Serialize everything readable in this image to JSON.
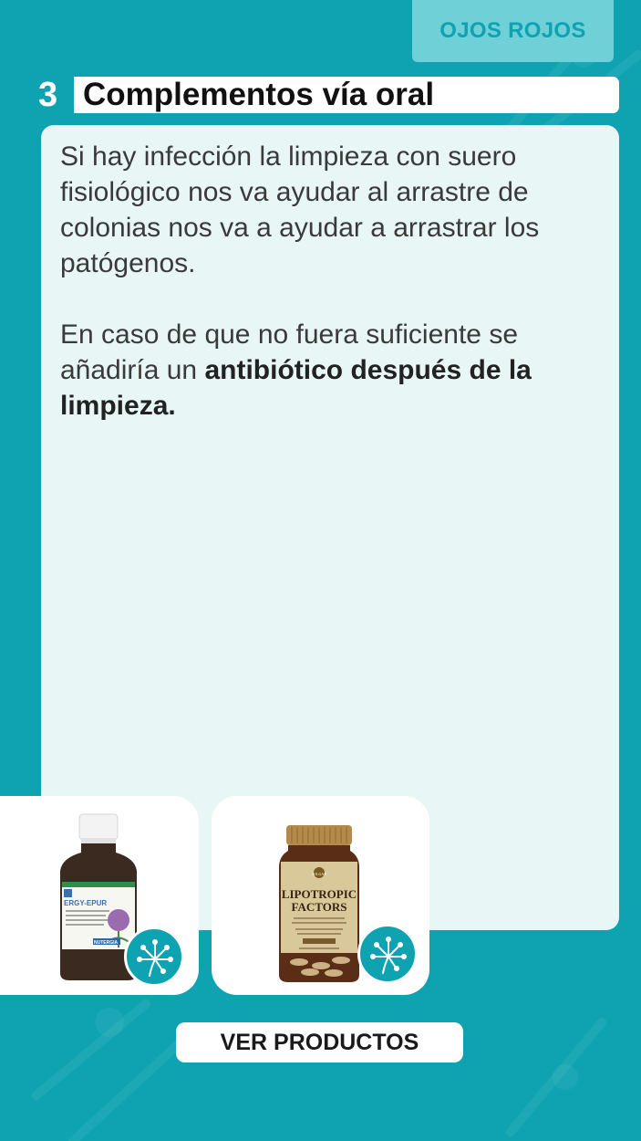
{
  "header": {
    "tab_label": "OJOS ROJOS",
    "step_number": "3",
    "section_title": "Complementos vía oral"
  },
  "content": {
    "paragraph1": "Si hay infección la limpieza con suero fisiológico nos va ayudar al arrastre de colonias nos va a ayudar a arrastrar los patógenos.",
    "paragraph2_prefix": "En caso de que no fuera suficiente se añadiría un ",
    "paragraph2_bold": "antibiótico después de la limpieza."
  },
  "products": [
    {
      "name": "ERGY-EPUR",
      "brand": "NUTERGIA",
      "icon": "syrup-bottle-icon"
    },
    {
      "name_line1": "LIPOTROPIC",
      "name_line2": "FACTORS",
      "brand": "SOLGAR",
      "icon": "supplement-jar-icon"
    }
  ],
  "cta": {
    "label": "VER PRODUCTOS"
  },
  "colors": {
    "background": "#0fa3b1",
    "tab": "#6fd0d8",
    "card": "#e8f6f6",
    "white": "#ffffff"
  }
}
